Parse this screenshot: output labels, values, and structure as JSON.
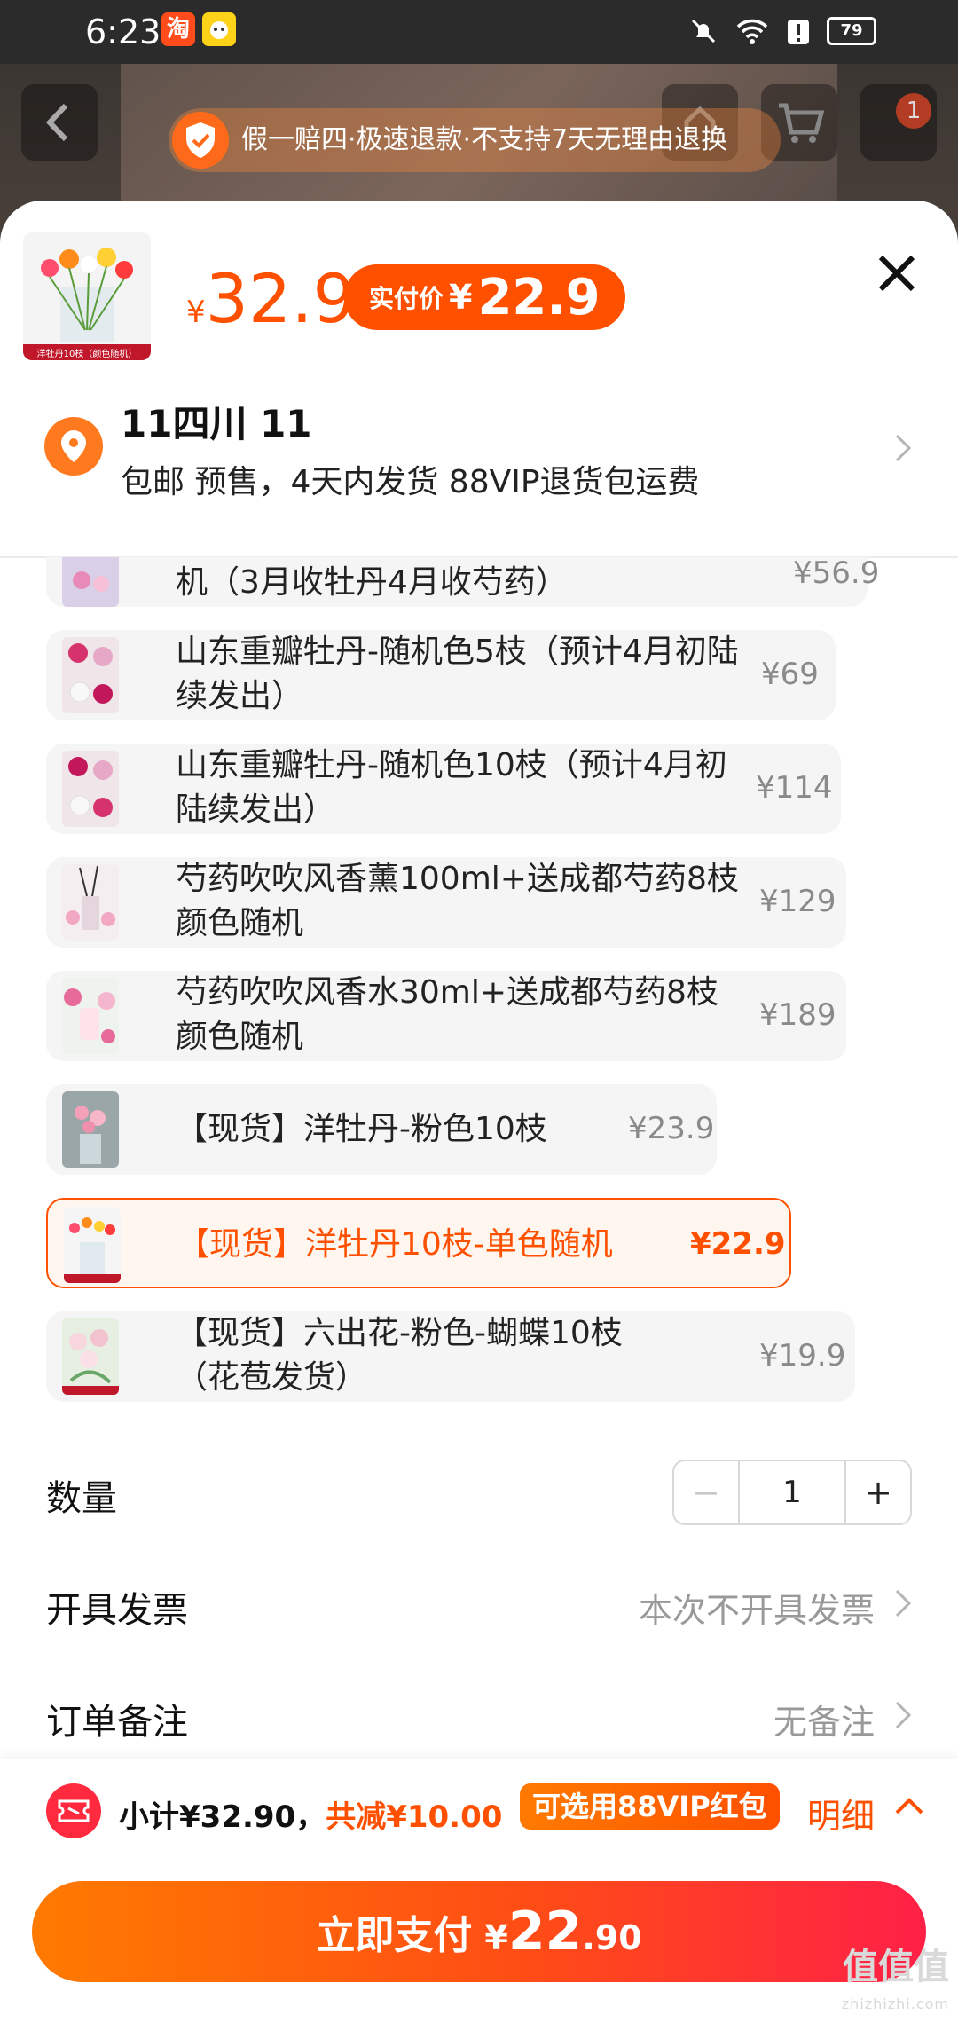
{
  "status_bar": {
    "time": "6:23",
    "app1": "淘",
    "battery": "79"
  },
  "guarantee": {
    "text": "假一赔四·极速退款·不支持7天无理由退换"
  },
  "cart_badge": "1",
  "product": {
    "thumb_caption": "洋牡丹10枝（颜色随机）",
    "price_currency": "¥",
    "price": "32.9",
    "pay_label": "实付价",
    "pay_currency": "¥",
    "pay_price": "22.9"
  },
  "address": {
    "name": "11四川 11",
    "sub": "包邮 预售，4天内发货 88VIP退货包运费"
  },
  "options": [
    {
      "text": "机（3月收牡丹4月收芍药）",
      "price": "¥56.9"
    },
    {
      "text": "山东重瓣牡丹-随机色5枝（预计4月初陆续发出）",
      "price": "¥69"
    },
    {
      "text": "山东重瓣牡丹-随机色10枝（预计4月初陆续发出）",
      "price": "¥114"
    },
    {
      "text": "芍药吹吹风香薰100ml+送成都芍药8枝颜色随机",
      "price": "¥129"
    },
    {
      "text": "芍药吹吹风香水30ml+送成都芍药8枝颜色随机",
      "price": "¥189"
    },
    {
      "text": "【现货】洋牡丹-粉色10枝",
      "price": "¥23.9"
    },
    {
      "text": "【现货】洋牡丹10枝-单色随机",
      "price": "¥22.9",
      "selected": true
    },
    {
      "text": "【现货】六出花-粉色-蝴蝶10枝（花苞发货）",
      "price": "¥19.9"
    }
  ],
  "quantity": {
    "label": "数量",
    "minus": "−",
    "value": "1",
    "plus": "+"
  },
  "invoice": {
    "label": "开具发票",
    "value": "本次不开具发票"
  },
  "note": {
    "label": "订单备注",
    "value": "无备注"
  },
  "footer": {
    "subtotal_prefix": "小计¥32.90，",
    "discount": "共减¥10.00",
    "vip_button": "可选用88VIP红包",
    "detail": "明细",
    "pay_label": "立即支付",
    "pay_currency": "¥",
    "pay_int": "22",
    "pay_dec": ".90"
  },
  "watermark": {
    "main": "值值值",
    "sub": "zhizhizhi.com"
  },
  "colors": {
    "accent": "#ff5000",
    "selected_bg": "#fff6f0",
    "option_bg": "#f5f5f5"
  }
}
